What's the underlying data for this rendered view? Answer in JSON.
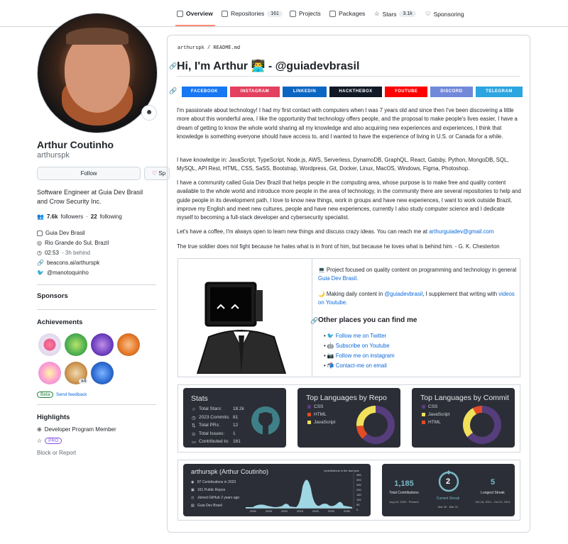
{
  "nav": {
    "tabs": [
      {
        "label": "Overview"
      },
      {
        "label": "Repositories",
        "count": "161"
      },
      {
        "label": "Projects"
      },
      {
        "label": "Packages"
      },
      {
        "label": "Stars",
        "count": "3.1k"
      },
      {
        "label": "Sponsoring"
      }
    ]
  },
  "profile": {
    "name": "Arthur Coutinho",
    "login": "arthurspk",
    "follow_label": "Follow",
    "sponsor_label": "Sp",
    "bio": "Software Engineer at Guia Dev Brasil and Crow Security Inc.",
    "followers": "7.6k",
    "followers_label": "followers",
    "following": "22",
    "following_label": "following",
    "sep": "·",
    "company": "Guia Dev Brasil",
    "location": "Rio Grande do Sul, Brazil",
    "time": "02:53",
    "time_note": "- 3h behind",
    "website": "beacons.ai/arthurspk",
    "twitter": "@manotoquinho",
    "status_emoji": "☻"
  },
  "sidebar": {
    "sponsors_title": "Sponsors",
    "achievements_title": "Achievements",
    "achievement_count": "x4",
    "beta_label": "Beta",
    "feedback_label": "Send feedback",
    "highlights_title": "Highlights",
    "highlight_program": "Developer Program Member",
    "pro_label": "PRO",
    "block_label": "Block or Report"
  },
  "readme": {
    "breadcrumb_user": "arthurspk",
    "breadcrumb_sep": "/",
    "breadcrumb_file": "README.md",
    "title": "Hi, I'm Arthur 👨‍💻 - @guiadevbrasil",
    "social": [
      {
        "label": "FACEBOOK",
        "color": "#1877f2"
      },
      {
        "label": "INSTAGRAM",
        "color": "#e4405f"
      },
      {
        "label": "LINKEDIN",
        "color": "#0a66c2"
      },
      {
        "label": "HACKTHEBOX",
        "color": "#111927"
      },
      {
        "label": "YOUTUBE",
        "color": "#ff0000"
      },
      {
        "label": "DISCORD",
        "color": "#7289da"
      },
      {
        "label": "TELEGRAM",
        "color": "#2ca5e0"
      }
    ],
    "p1": "I'm passionate about technology! I had my first contact with computers when I was 7 years old and since then I've been discovering a little more about this wonderful area, I like the opportunity that technology offers people, and the proposal to make people's lives easier, I have a dream of getting to know the whole world sharing all my knowledge and also acquiring new experiences and experiences, I think that knowledge is something everyone should have access to, and I wanted to have the experience of living in U.S. or Canada for a while.",
    "p2": "I have knowledge in: JavaScript, TypeScript, Node.js, AWS, Serverless, DynamoDB, GraphQL, React, Gatsby, Python, MongoDB, SQL, MySQL, API Rest, HTML, CSS, SaSS, Bootstrap, Wordpress, Git, Docker, Linux, MacOS, Windows, Figma, Photoshop.",
    "p3": "I have a community called Guia Dev Brazil that helps people in the computing area, whose purpose is to make free and quality content available to the whole world and introduce more people in the area of technology, in the community there are several repositories to help and guide people in its development path, I love to know new things, work in groups and have new experiences, I want to work outside Brazil, improve my English and meet new cultures, people and have new experiences, currently I also study computer science and I dedicate myself to becoming a full-stack developer and cybersecurity specialist.",
    "p4_text": "Let's have a coffee, I'm always open to learn new things and discuss crazy ideas. You can reach me at",
    "p4_email": "arthurguiadev@gmail.com",
    "p5": "The true soldier does not fight because he hates what is in front of him, but because he loves what is behind him. - G. K. Chesterton",
    "project_text": "💻 Project focused on quality content on programming and technology in general",
    "project_link": "Guia Dev Brasil.",
    "content_pre": "🌙 Making daily content in",
    "content_link1": "@guiadevbrasil",
    "content_mid": ", I supplement that writing with",
    "content_link2": "videos on Youtube.",
    "other_title": "Other places you can find me",
    "other_links": [
      {
        "emoji": "🐦",
        "label": "Follow me on Twitter"
      },
      {
        "emoji": "🤖",
        "label": "Subscribe on Youtube"
      },
      {
        "emoji": "📷",
        "label": "Follow me on instagram"
      },
      {
        "emoji": "📬",
        "label": "Contact-me on email"
      }
    ]
  },
  "stats": {
    "title": "Stats",
    "rows": [
      {
        "label": "Total Stars:",
        "value": "18.2k"
      },
      {
        "label": "2023 Commits:",
        "value": "81"
      },
      {
        "label": "Total PRs:",
        "value": "12"
      },
      {
        "label": "Total Issues:",
        "value": "1"
      },
      {
        "label": "Contributed to:",
        "value": "161"
      }
    ]
  },
  "langs_repo": {
    "title": "Top Languages by Repo",
    "items": [
      {
        "name": "CSS",
        "color": "#563d7c",
        "share": 0.62
      },
      {
        "name": "HTML",
        "color": "#e34c26",
        "share": 0.12
      },
      {
        "name": "JavaScript",
        "color": "#f1e05a",
        "share": 0.26
      }
    ]
  },
  "langs_commit": {
    "title": "Top Languages by Commit",
    "items": [
      {
        "name": "CSS",
        "color": "#563d7c",
        "share": 0.64
      },
      {
        "name": "JavaScript",
        "color": "#f1e05a",
        "share": 0.28
      },
      {
        "name": "HTML",
        "color": "#e34c26",
        "share": 0.08
      }
    ]
  },
  "activity": {
    "title": "arthurspk (Arthur Coutinho)",
    "lines": [
      "87 Contributions in 2023",
      "161 Public Repos",
      "Joined GitHub 2 years ago",
      "Guia Dev Brasil"
    ],
    "chart_label": "contributions in the last year",
    "y_ticks": [
      "350",
      "300",
      "250",
      "200",
      "150",
      "100",
      "50",
      "0"
    ],
    "x_ticks": [
      "2000",
      "2005",
      "2010",
      "2015",
      "2020",
      "2025",
      "2030"
    ]
  },
  "streak": {
    "total": "1,185",
    "total_label": "Total Contributions",
    "total_range": "Aug 16, 2020 - Present",
    "current": "2",
    "current_label": "Current Streak",
    "current_range": "Mar 30 - Mar 31",
    "longest": "5",
    "longest_label": "Longest Streak",
    "longest_range": "Oct 18, 2021 - Oct 22, 2021"
  }
}
